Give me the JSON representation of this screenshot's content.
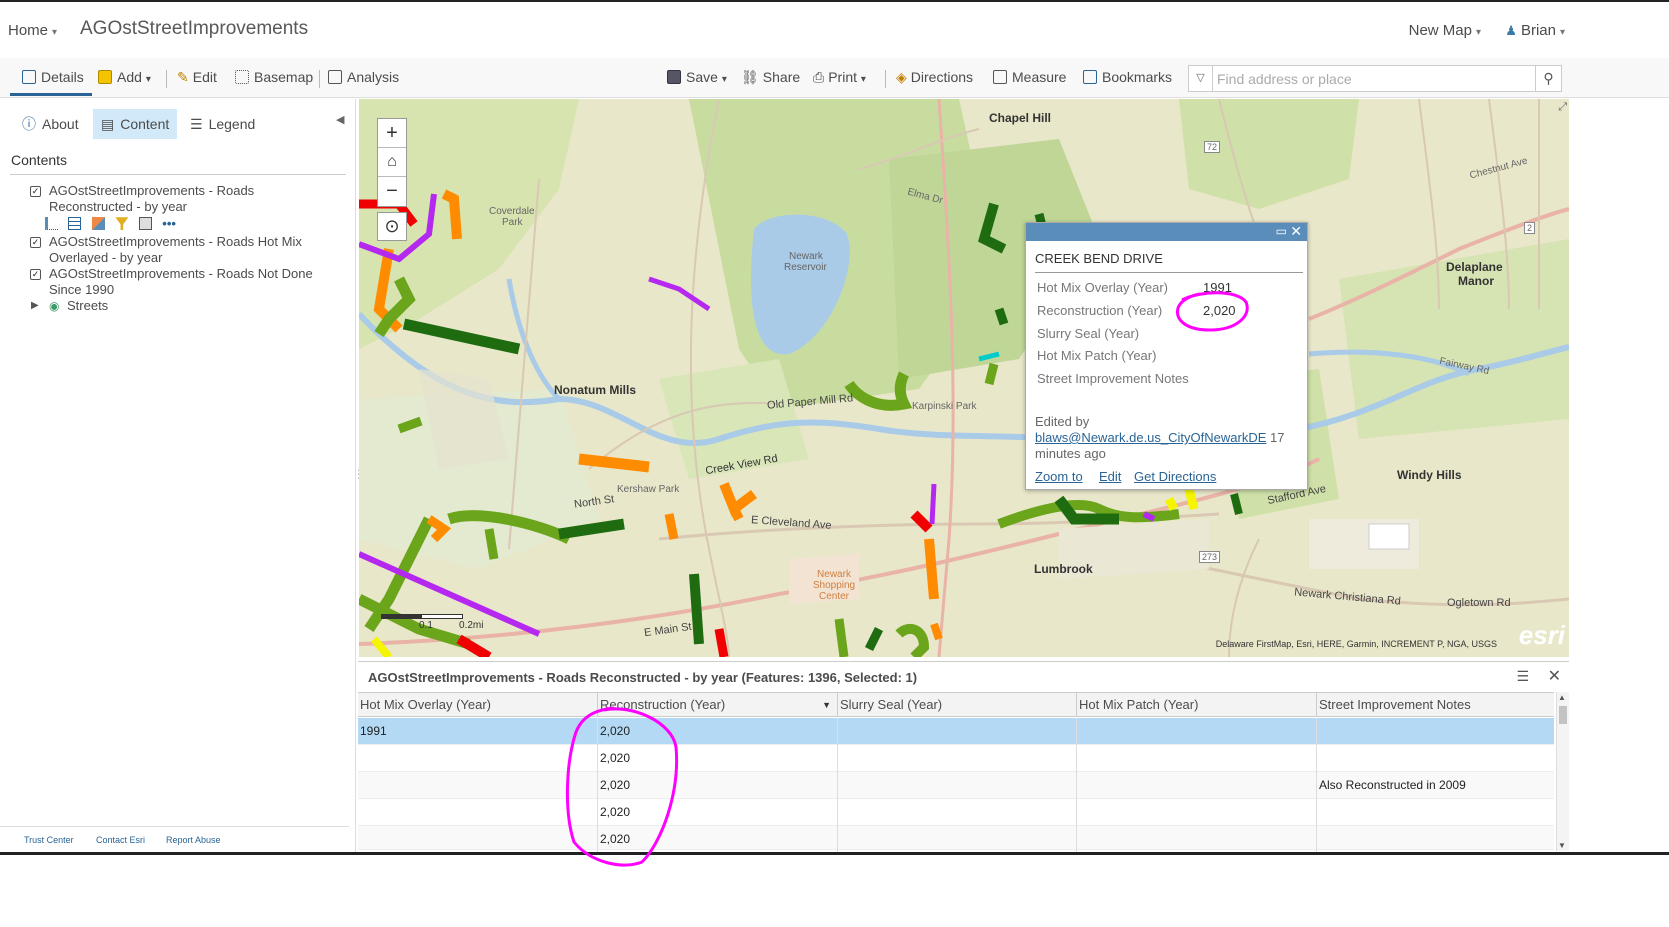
{
  "header": {
    "home_label": "Home",
    "app_title": "AGOstStreetImprovements",
    "new_map_label": "New Map",
    "user_name": "Brian"
  },
  "toolbar": {
    "details": "Details",
    "add": "Add",
    "edit": "Edit",
    "basemap": "Basemap",
    "analysis": "Analysis",
    "save": "Save",
    "share": "Share",
    "print": "Print",
    "directions": "Directions",
    "measure": "Measure",
    "bookmarks": "Bookmarks",
    "search_placeholder": "Find address or place"
  },
  "panel": {
    "tabs": {
      "about": "About",
      "content": "Content",
      "legend": "Legend"
    },
    "contents_heading": "Contents",
    "layers": [
      {
        "name_line1": "AGOstStreetImprovements - Roads",
        "name_line2": "Reconstructed - by year",
        "checked": true
      },
      {
        "name_line1": "AGOstStreetImprovements - Roads Hot Mix",
        "name_line2": "Overlayed - by year",
        "checked": true
      },
      {
        "name_line1": "AGOstStreetImprovements - Roads Not Done",
        "name_line2": "Since 1990",
        "checked": true
      },
      {
        "name_line1": "Streets",
        "name_line2": "",
        "checked": false
      }
    ],
    "footer": {
      "trust": "Trust Center",
      "contact": "Contact Esri",
      "abuse": "Report Abuse"
    }
  },
  "map": {
    "labels": {
      "chapel_hill": "Chapel Hill",
      "nonatum_mills": "Nonatum Mills",
      "delaplane_manor_1": "Delaplane",
      "delaplane_manor_2": "Manor",
      "windy_hills": "Windy Hills",
      "lumbrook": "Lumbrook",
      "newark_reservoir_1": "Newark",
      "newark_reservoir_2": "Reservoir",
      "coverdale_1": "Coverdale",
      "coverdale_2": "Park",
      "elma_dr": "Elma Dr",
      "creek_view_rd": "Creek View Rd",
      "e_cleveland_ave": "E Cleveland Ave",
      "stafford_ave": "Stafford Ave",
      "old_paper_mill_rd": "Old Paper Mill Rd",
      "newark_christiana_rd": "Newark Christiana Rd",
      "ogletown_rd": "Ogletown Rd",
      "chestnut_ave": "Chestnut Ave",
      "fairway_rd": "Fairway Rd",
      "kershaw_park": "Kershaw Park",
      "karpinski_park": "Karpinski Park",
      "north_st": "North St",
      "e_main_st": "E Main St",
      "newark_shopping_center": "Newark Shopping Center",
      "route_72": "72",
      "route_273": "273",
      "route_2": "2"
    },
    "scale_labels": {
      "a": "0.1",
      "b": "0.2mi"
    },
    "attribution": "Delaware FirstMap, Esri, HERE, Garmin, INCREMENT P, NGA, USGS",
    "esri_logo": "esri"
  },
  "popup": {
    "title": "CREEK BEND DRIVE",
    "fields": [
      {
        "label": "Hot Mix Overlay (Year)",
        "value": "1991"
      },
      {
        "label": "Reconstruction (Year)",
        "value": "2,020"
      },
      {
        "label": "Slurry Seal (Year)",
        "value": ""
      },
      {
        "label": "Hot Mix Patch (Year)",
        "value": ""
      },
      {
        "label": "Street Improvement Notes",
        "value": ""
      }
    ],
    "edited_by": "Edited by",
    "editor": "blaws@Newark.de.us_CityOfNewarkDE",
    "edited_when": "17 minutes ago",
    "actions": {
      "zoom": "Zoom to",
      "edit": "Edit",
      "directions": "Get Directions"
    }
  },
  "table": {
    "title": "AGOstStreetImprovements - Roads Reconstructed - by year (Features: 1396, Selected: 1)",
    "columns": [
      "Hot Mix Overlay (Year)",
      "Reconstruction (Year)",
      "Slurry Seal (Year)",
      "Hot Mix Patch (Year)",
      "Street Improvement Notes"
    ],
    "rows": [
      [
        "1991",
        "2,020",
        "",
        "",
        ""
      ],
      [
        "",
        "2,020",
        "",
        "",
        ""
      ],
      [
        "",
        "2,020",
        "",
        "",
        "Also Reconstructed in 2009"
      ],
      [
        "",
        "2,020",
        "",
        "",
        ""
      ],
      [
        "",
        "2,020",
        "",
        "",
        ""
      ]
    ]
  },
  "colors": {
    "accent": "#2a6496",
    "popup_header": "#5b8dba",
    "selected_row": "#b3d9f5",
    "annotation": "#ff00ff",
    "road_dark_green": "#1e6b10",
    "road_light_green": "#6aa51c",
    "road_orange": "#ff8c00",
    "road_purple": "#b428f0",
    "road_red": "#f00000",
    "road_yellow": "#f5f500"
  }
}
